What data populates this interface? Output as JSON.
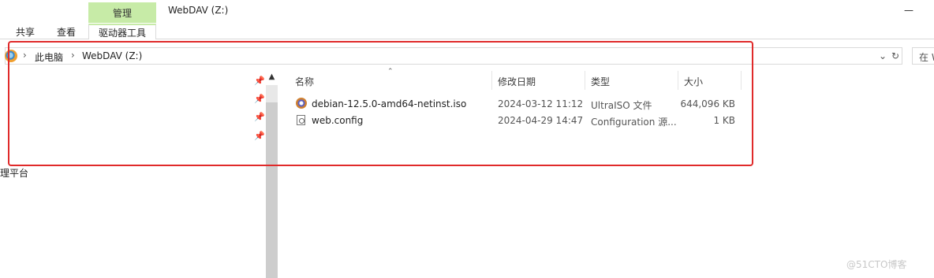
{
  "window": {
    "title": "WebDAV (Z:)",
    "minimize": "—"
  },
  "ribbon": {
    "context_tab": "管理",
    "tabs": [
      "共享",
      "查看",
      "驱动器工具"
    ]
  },
  "address": {
    "crumbs": [
      "此电脑",
      "WebDAV (Z:)"
    ],
    "search_placeholder": "在 W"
  },
  "nav": {
    "clipped_item": "理平台"
  },
  "columns": [
    "名称",
    "修改日期",
    "类型",
    "大小"
  ],
  "files": [
    {
      "name": "debian-12.5.0-amd64-netinst.iso",
      "modified": "2024-03-12 11:12",
      "type": "UltraISO 文件",
      "size": "644,096 KB",
      "icon": "iso-disc-icon"
    },
    {
      "name": "web.config",
      "modified": "2024-04-29 14:47",
      "type": "Configuration 源...",
      "size": "1 KB",
      "icon": "config-file-icon"
    }
  ],
  "watermark": "@51CTO博客",
  "colors": {
    "manage_tab": "#c7eba7",
    "highlight": "#e02a2a"
  }
}
